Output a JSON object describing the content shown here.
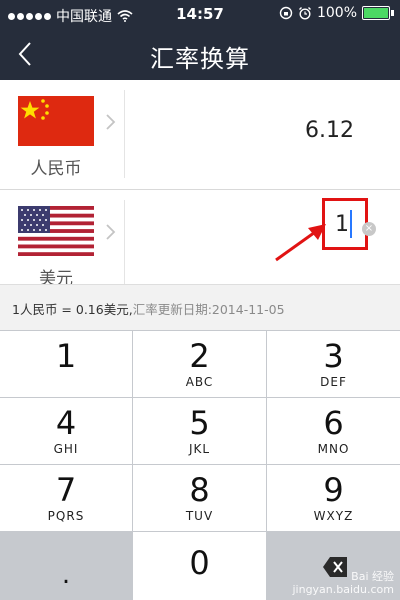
{
  "status_bar": {
    "carrier": "中国联通",
    "time": "14:57",
    "battery": "100%"
  },
  "nav": {
    "title": "汇率换算"
  },
  "from_currency": {
    "name": "人民币",
    "amount": "6.12",
    "flag": "china-flag"
  },
  "to_currency": {
    "name": "美元",
    "amount": "1",
    "flag": "usa-flag"
  },
  "rate_info": {
    "rate_text": "1人民币 = 0.16美元,",
    "update_text": "汇率更新日期:2014-11-05"
  },
  "keypad": {
    "keys": [
      {
        "num": "1",
        "letters": ""
      },
      {
        "num": "2",
        "letters": "ABC"
      },
      {
        "num": "3",
        "letters": "DEF"
      },
      {
        "num": "4",
        "letters": "GHI"
      },
      {
        "num": "5",
        "letters": "JKL"
      },
      {
        "num": "6",
        "letters": "MNO"
      },
      {
        "num": "7",
        "letters": "PQRS"
      },
      {
        "num": "8",
        "letters": "TUV"
      },
      {
        "num": "9",
        "letters": "WXYZ"
      },
      {
        "num": ".",
        "letters": ""
      },
      {
        "num": "0",
        "letters": ""
      }
    ]
  },
  "watermark": {
    "line1": "Bai 经验",
    "line2": "jingyan.baidu.com"
  },
  "colors": {
    "nav_bg": "#262d3b",
    "highlight": "#e11313",
    "keypad_bg": "#c6c9ce",
    "battery": "#4cd964"
  }
}
